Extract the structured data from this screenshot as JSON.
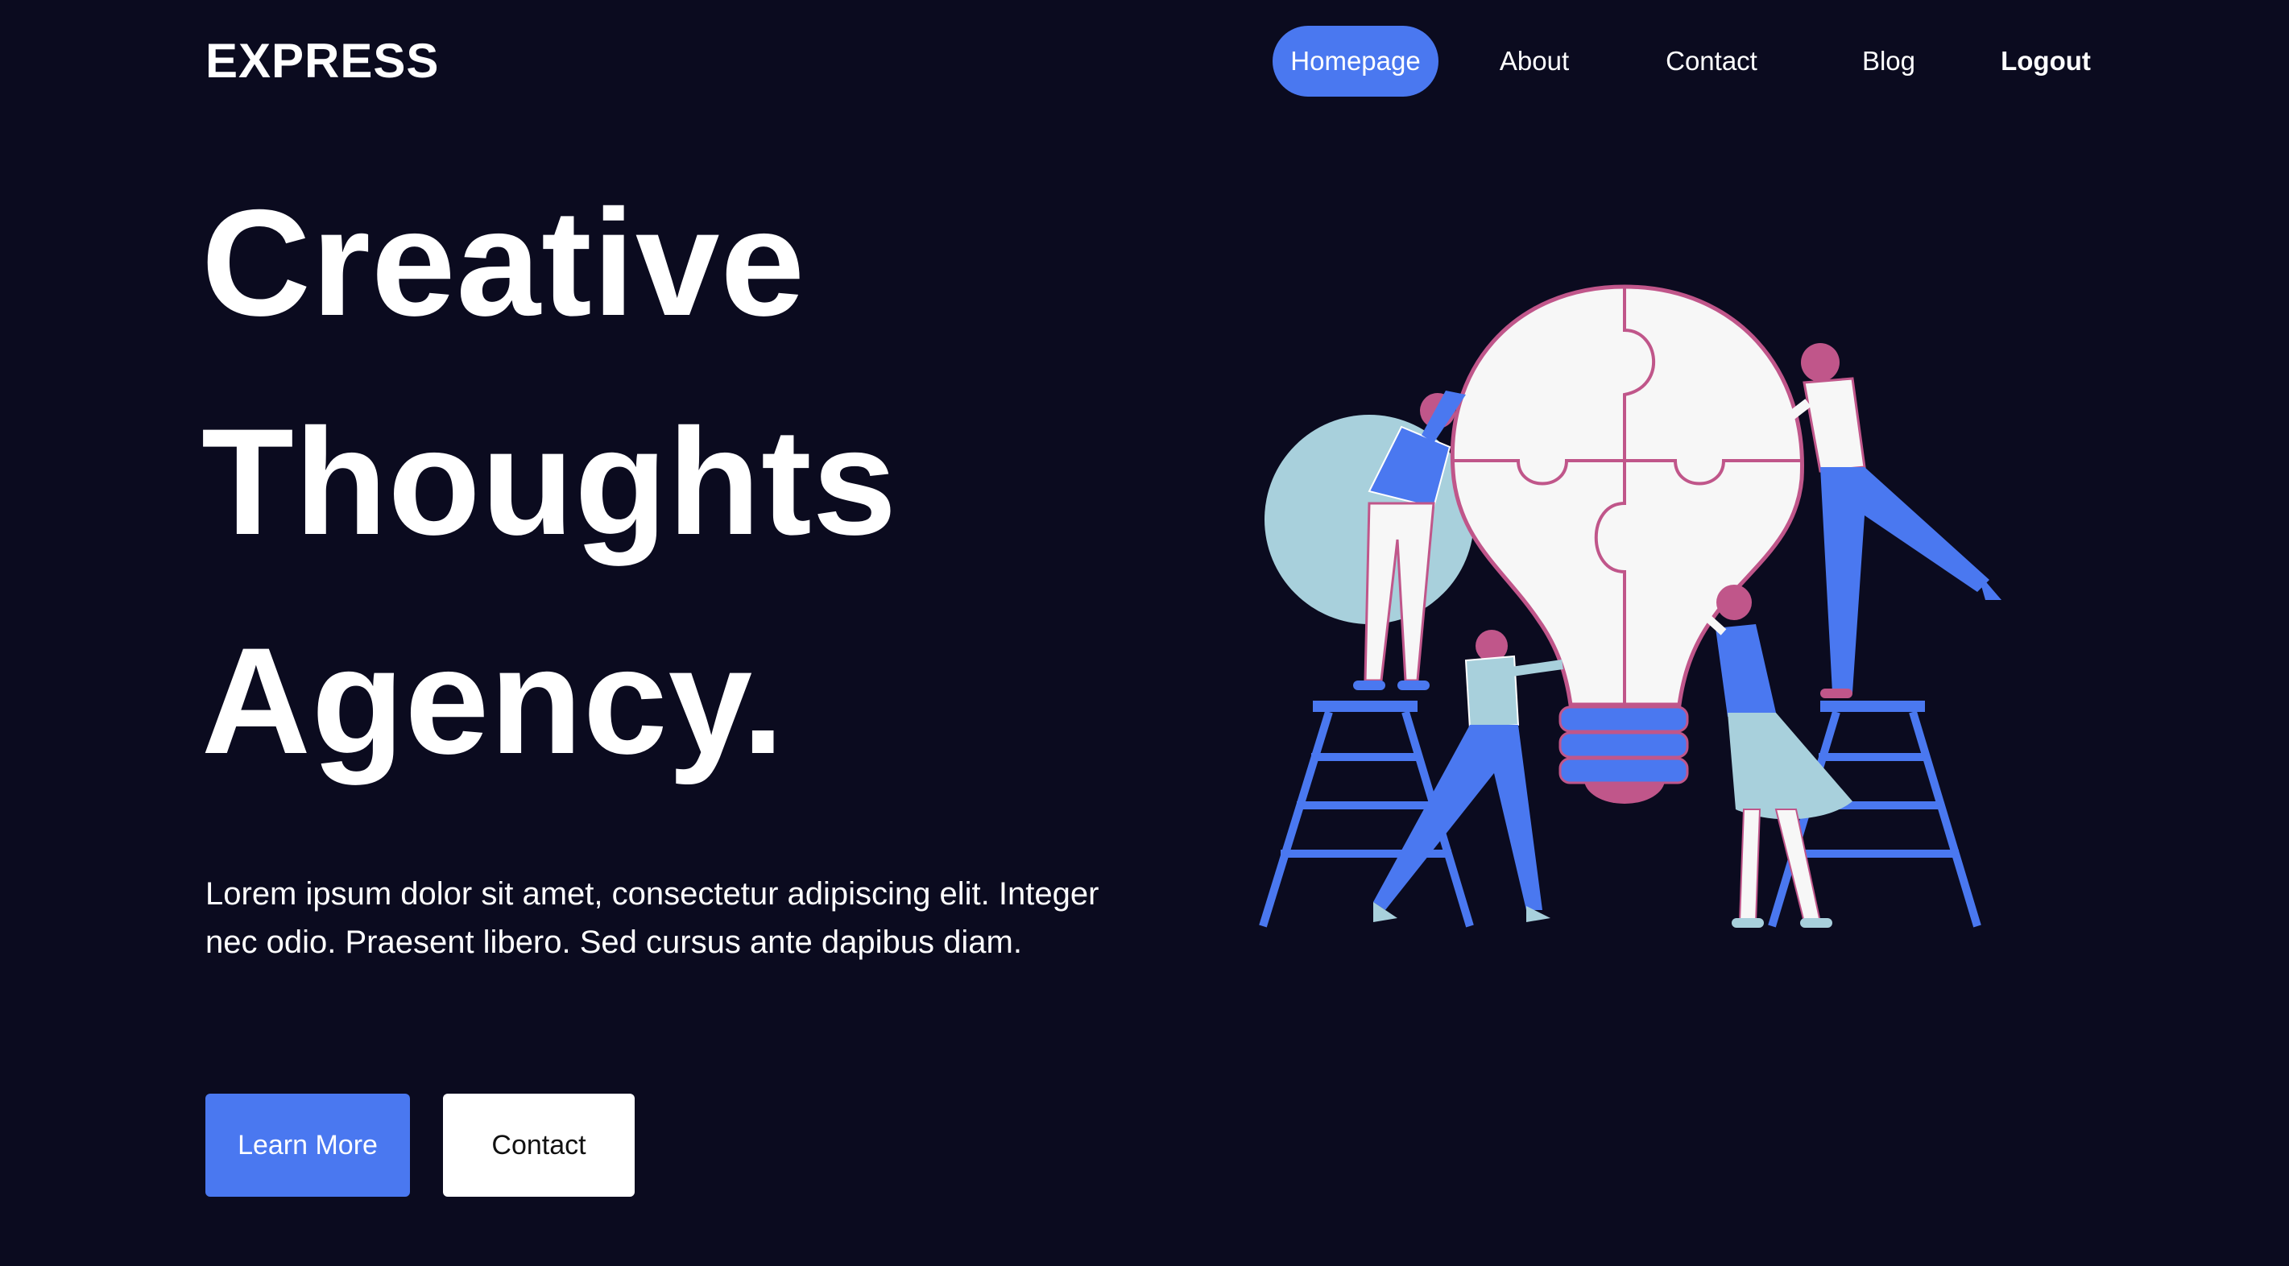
{
  "brand": "EXPRESS",
  "nav": {
    "homepage": "Homepage",
    "about": "About",
    "contact": "Contact",
    "blog": "Blog",
    "logout": "Logout"
  },
  "hero": {
    "title_line1": "Creative",
    "title_line2": "Thoughts",
    "title_line3": "Agency.",
    "body": "Lorem ipsum dolor sit amet, consectetur adipiscing elit. Integer nec odio. Praesent libero. Sed cursus ante dapibus diam.",
    "primary_button": "Learn More",
    "secondary_button": "Contact"
  },
  "colors": {
    "background": "#0b0b1f",
    "accent": "#4a78f0",
    "pink": "#c0568a",
    "light_blue": "#a8d0dc"
  }
}
